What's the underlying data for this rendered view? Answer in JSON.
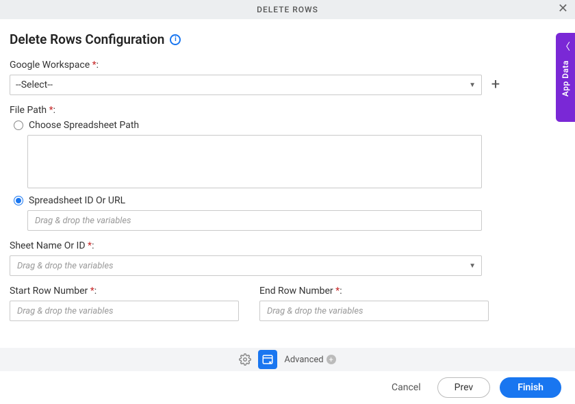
{
  "header": {
    "title": "DELETE ROWS"
  },
  "page": {
    "title": "Delete Rows Configuration"
  },
  "fields": {
    "google_workspace": {
      "label": "Google Workspace ",
      "value": "--Select--"
    },
    "file_path": {
      "label": "File Path ",
      "options": {
        "choose_path": "Choose Spreadsheet Path",
        "spreadsheet_id": "Spreadsheet ID Or URL"
      },
      "selected": "spreadsheet_id",
      "id_placeholder": "Drag & drop the variables"
    },
    "sheet_name": {
      "label": "Sheet Name Or ID ",
      "placeholder": "Drag & drop the variables"
    },
    "start_row": {
      "label": "Start Row Number ",
      "placeholder": "Drag & drop the variables"
    },
    "end_row": {
      "label": "End Row Number ",
      "placeholder": "Drag & drop the variables"
    }
  },
  "bottom": {
    "advanced": "Advanced"
  },
  "footer": {
    "cancel": "Cancel",
    "prev": "Prev",
    "finish": "Finish"
  },
  "side": {
    "label": "App Data"
  }
}
